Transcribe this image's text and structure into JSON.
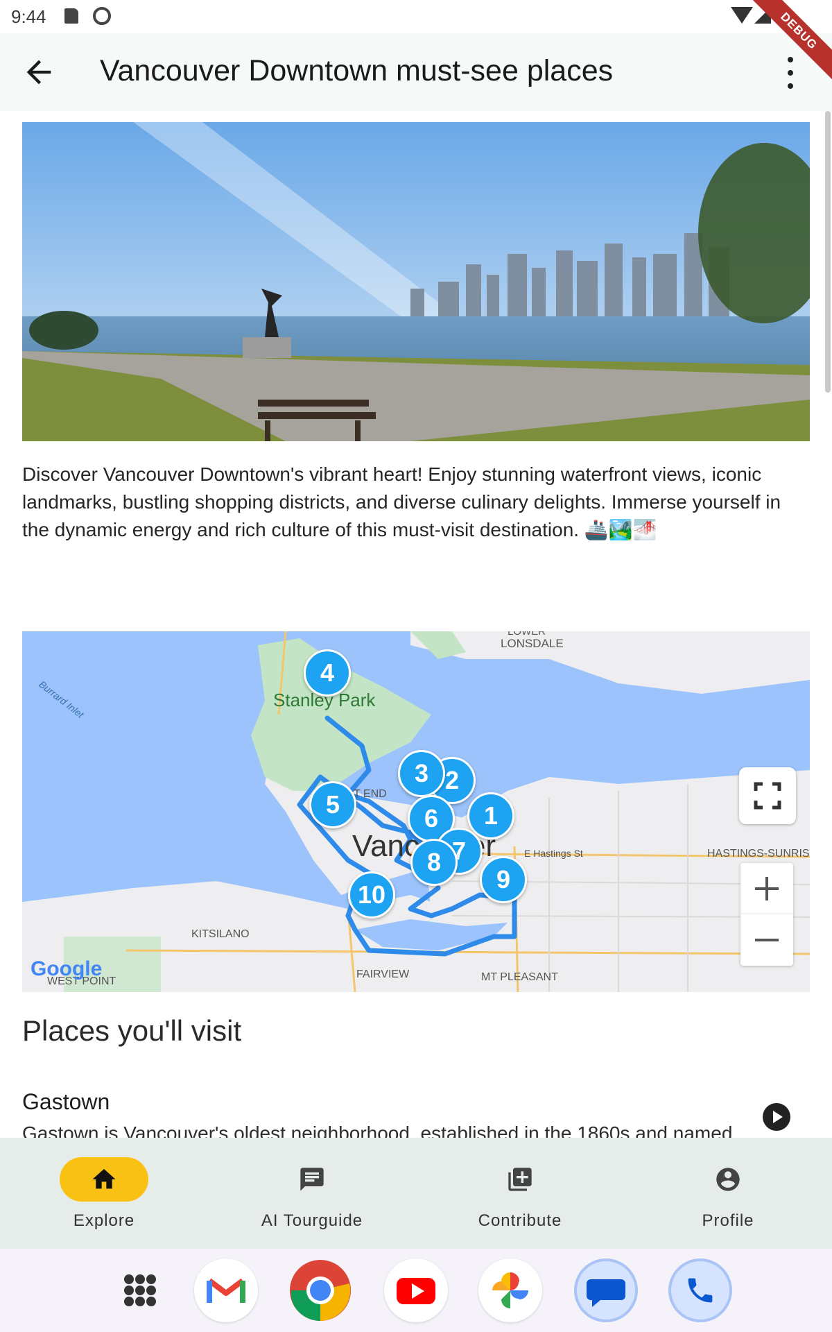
{
  "status_bar": {
    "time": "9:44",
    "debug_label": "DEBUG",
    "icons": [
      "sd-card-icon",
      "android-icon",
      "wifi-icon",
      "signal-icon"
    ]
  },
  "app_bar": {
    "title": "Vancouver Downtown must-see places",
    "back_icon": "arrow-back-icon",
    "menu_icon": "more-vert-icon"
  },
  "description": "Discover Vancouver Downtown's vibrant heart! Enjoy stunning waterfront views, iconic landmarks, bustling shopping districts, and diverse culinary delights. Immerse yourself in the dynamic energy and rich culture of this must-visit destination. 🚢🏞️🌁",
  "map": {
    "labels": {
      "stanley_park": "Stanley Park",
      "burrard_inlet": "Burrard Inlet",
      "lower_lonsdale_top": "LOWER",
      "lower_lonsdale": "LONSDALE",
      "vancouver": "Vancouver",
      "west_end": "T END",
      "e_hastings": "E Hastings St",
      "hastings_sunrise": "HASTINGS-SUNRIS",
      "kitsilano": "KITSILANO",
      "fairview": "FAIRVIEW",
      "mt_pleasant": "MT PLEASANT",
      "west_point": "WEST POINT",
      "google": "Google"
    },
    "markers": [
      "1",
      "2",
      "3",
      "4",
      "5",
      "6",
      "7",
      "8",
      "9",
      "10"
    ],
    "colors": {
      "water": "#9cc3fb",
      "land": "#eeeef0",
      "park": "#c3e5c5",
      "route": "#2f8bea",
      "marker": "#1ea3f3"
    }
  },
  "places": {
    "section_title": "Places you'll visit",
    "items": [
      {
        "name": "Gastown",
        "snippet": "Gastown is Vancouver's oldest neighborhood, established in the 1860s and named"
      }
    ]
  },
  "bottom_nav": {
    "items": [
      {
        "label": "Explore",
        "icon": "home-icon",
        "active": true
      },
      {
        "label": "AI Tourguide",
        "icon": "chat-icon",
        "active": false
      },
      {
        "label": "Contribute",
        "icon": "add-box-icon",
        "active": false
      },
      {
        "label": "Profile",
        "icon": "account-circle-icon",
        "active": false
      }
    ],
    "active_color": "#f9c114"
  },
  "dock": {
    "apps": [
      "app-drawer-icon",
      "gmail-icon",
      "chrome-icon",
      "youtube-icon",
      "photos-icon",
      "messages-icon",
      "phone-icon"
    ]
  }
}
